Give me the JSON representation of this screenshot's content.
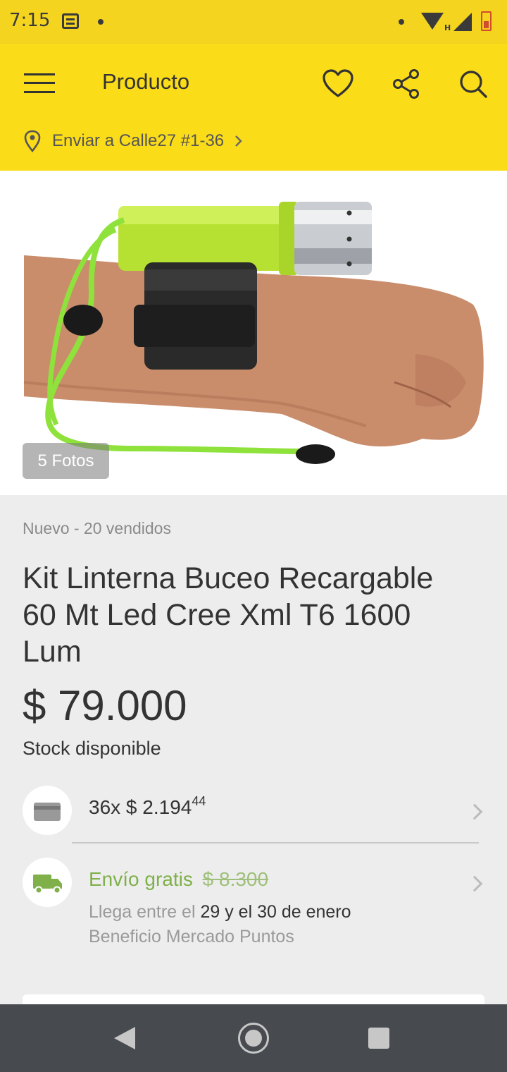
{
  "status_bar": {
    "time": "7:15",
    "network_label": "H"
  },
  "header": {
    "title": "Producto",
    "ship_to": "Enviar a Calle27 #1-36"
  },
  "gallery": {
    "photo_count": "5 Fotos"
  },
  "product": {
    "condition": "Nuevo - 20 vendidos",
    "title": "Kit Linterna Buceo Recargable 60 Mt Led Cree Xml T6 1600 Lum",
    "price": "$ 79.000",
    "stock": "Stock disponible"
  },
  "installments": {
    "label": "36x $ 2.194",
    "cents": "44"
  },
  "shipping": {
    "label": "Envío gratis",
    "old_price": "$ 8.300",
    "arrives_prefix": "Llega entre el",
    "arrives_dates": "29 y el 30 de enero",
    "benefit": "Beneficio Mercado Puntos"
  },
  "colors": {
    "brand_yellow": "#fbdc19",
    "shipping_green": "#7fb04a",
    "navbar": "#474a4e"
  }
}
